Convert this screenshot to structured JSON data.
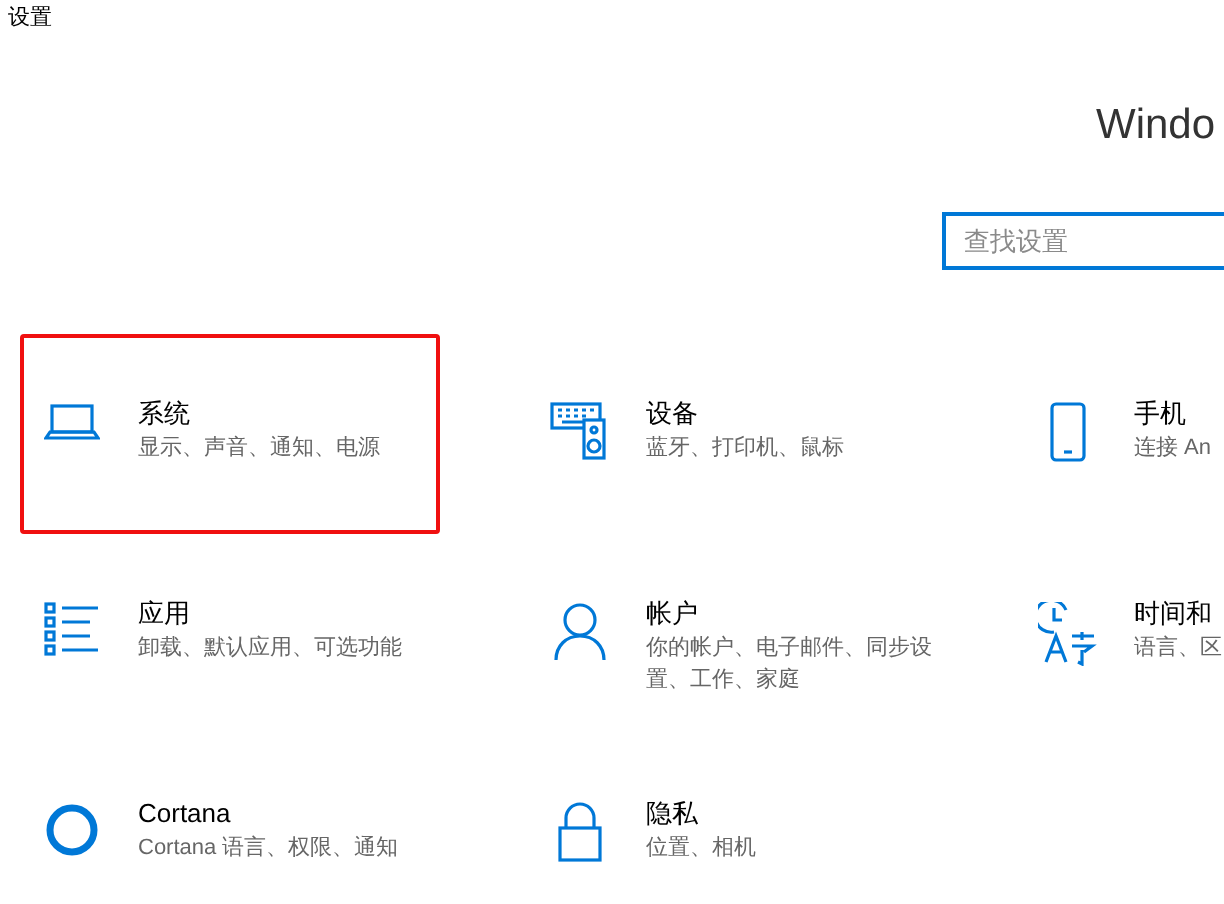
{
  "window": {
    "title": "设置"
  },
  "header": {
    "title": "Windo"
  },
  "search": {
    "placeholder": "查找设置"
  },
  "tiles": [
    {
      "kind": "laptop",
      "title": "系统",
      "subtitle": "显示、声音、通知、电源",
      "selected": true
    },
    {
      "kind": "devices",
      "title": "设备",
      "subtitle": "蓝牙、打印机、鼠标",
      "selected": false
    },
    {
      "kind": "phone",
      "title": "手机",
      "subtitle": "连接 An",
      "selected": false
    },
    {
      "kind": "apps",
      "title": "应用",
      "subtitle": "卸载、默认应用、可选功能",
      "selected": false
    },
    {
      "kind": "account",
      "title": "帐户",
      "subtitle": "你的帐户、电子邮件、同步设置、工作、家庭",
      "selected": false
    },
    {
      "kind": "time-language",
      "title": "时间和",
      "subtitle": "语言、区",
      "selected": false
    },
    {
      "kind": "cortana",
      "title": "Cortana",
      "subtitle": "Cortana 语言、权限、通知",
      "selected": false
    },
    {
      "kind": "privacy",
      "title": "隐私",
      "subtitle": "位置、相机",
      "selected": false
    }
  ]
}
